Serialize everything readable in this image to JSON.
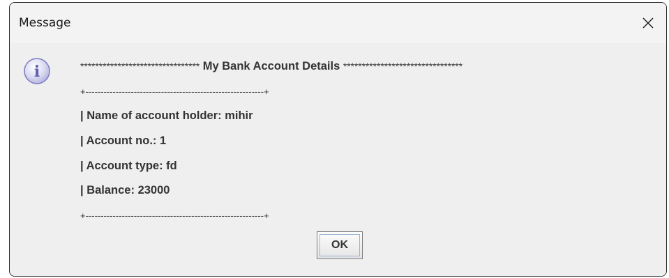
{
  "window": {
    "title": "Message",
    "close_glyph": "X"
  },
  "icon": {
    "name": "info-icon",
    "glyph": "i",
    "color": "#7b7bc4"
  },
  "message": {
    "header_stars_left": "********************************",
    "header_title": " My Bank Account Details ",
    "header_stars_right": "********************************",
    "border_top": "+-----------------------------------------------------------+",
    "lines": [
      "| Name of account holder: mihir",
      "| Account no.: 1",
      "| Account type: fd",
      "| Balance: 23000"
    ],
    "border_bottom": "+-----------------------------------------------------------+"
  },
  "buttons": {
    "ok_label": "OK"
  }
}
